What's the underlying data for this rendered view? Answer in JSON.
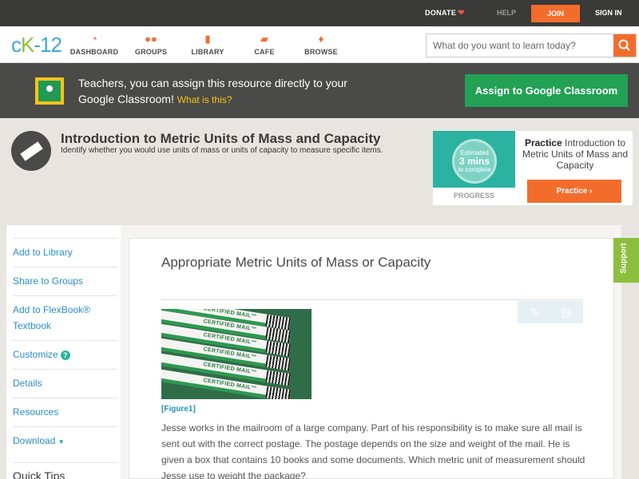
{
  "topbar": {
    "donate": "DONATE",
    "help": "HELP",
    "join": "JOIN",
    "sign_in": "SIGN IN"
  },
  "logo": {
    "c": "c",
    "k": "K",
    "rest": "-12"
  },
  "nav": {
    "items": [
      {
        "label": "DASHBOARD",
        "icon": "gauge-icon"
      },
      {
        "label": "GROUPS",
        "icon": "people-icon"
      },
      {
        "label": "LIBRARY",
        "icon": "library-icon"
      },
      {
        "label": "CAFE",
        "icon": "chat-icon"
      },
      {
        "label": "BROWSE",
        "icon": "lightbulb-icon"
      }
    ],
    "search_placeholder": "What do you want to learn today?"
  },
  "banner": {
    "message": "Teachers, you can assign this resource directly to your Google Classroom!",
    "what_link": "What is this?",
    "assign_button": "Assign to Google Classroom"
  },
  "header": {
    "title": "Introduction to Metric Units of Mass and Capacity",
    "subtitle": "Identify whether you would use units of mass or units of capacity to measure specific items."
  },
  "practice_card": {
    "estimated": "Estimated",
    "minutes": "3 mins",
    "to_complete": "to complete",
    "progress_label": "PROGRESS",
    "practice_word": "Practice",
    "practice_title": "Introduction to Metric Units of Mass and Capacity",
    "practice_button": "Practice"
  },
  "sidebar": {
    "items": [
      "Add to Library",
      "Share to Groups",
      "Add to FlexBook® Textbook",
      "Customize",
      "Details",
      "Resources",
      "Download"
    ],
    "quick_tips": "Quick Tips"
  },
  "content": {
    "title": "Appropriate Metric Units of Mass or Capacity",
    "envelope_text": "CERTIFIED MAIL™",
    "figure_label": "[Figure1]",
    "paragraph": "Jesse works in the mailroom of a large company. Part of his responsibility is to make sure all mail is sent out with the correct postage. The postage depends on the size and weight of the mail. He is given a box that contains 10 books and some documents. Which metric unit of measurement should Jesse use to weight the package?"
  },
  "support_tab": "Support",
  "colors": {
    "accent_orange": "#f26d2b",
    "green": "#22a155",
    "link_blue": "#2a8ec7",
    "teal": "#2bb2a0",
    "dark_bar": "#3a3a38"
  }
}
